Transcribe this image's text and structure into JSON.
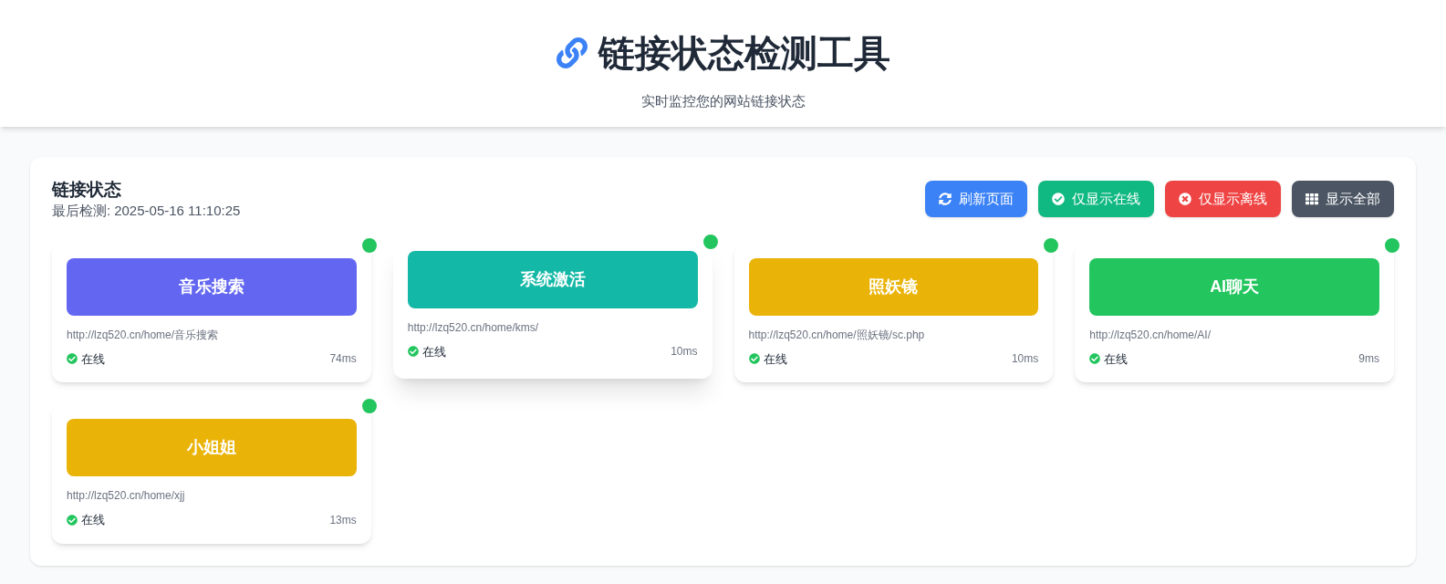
{
  "header": {
    "title": "链接状态检测工具",
    "subtitle": "实时监控您的网站链接状态"
  },
  "panel": {
    "title": "链接状态",
    "last_check_label": "最后检测:",
    "last_check_time": "2025-05-16 11:10:25"
  },
  "buttons": [
    {
      "kind": "refresh",
      "label": "刷新页面"
    },
    {
      "kind": "online",
      "label": "仅显示在线"
    },
    {
      "kind": "offline",
      "label": "仅显示离线"
    },
    {
      "kind": "all",
      "label": "显示全部"
    }
  ],
  "cards": [
    {
      "name": "音乐搜索",
      "color": "#6366f1",
      "url": "http://lzq520.cn/home/音乐搜索",
      "status": "在线",
      "online": true,
      "latency": "74ms",
      "hovered": false
    },
    {
      "name": "系统激活",
      "color": "#14b8a6",
      "url": "http://lzq520.cn/home/kms/",
      "status": "在线",
      "online": true,
      "latency": "10ms",
      "hovered": true
    },
    {
      "name": "照妖镜",
      "color": "#eab308",
      "url": "http://lzq520.cn/home/照妖镜/sc.php",
      "status": "在线",
      "online": true,
      "latency": "10ms",
      "hovered": false
    },
    {
      "name": "AI聊天",
      "color": "#22c55e",
      "url": "http://lzq520.cn/home/AI/",
      "status": "在线",
      "online": true,
      "latency": "9ms",
      "hovered": false
    },
    {
      "name": "小姐姐",
      "color": "#eab308",
      "url": "http://lzq520.cn/home/xjj",
      "status": "在线",
      "online": true,
      "latency": "13ms",
      "hovered": false
    }
  ]
}
